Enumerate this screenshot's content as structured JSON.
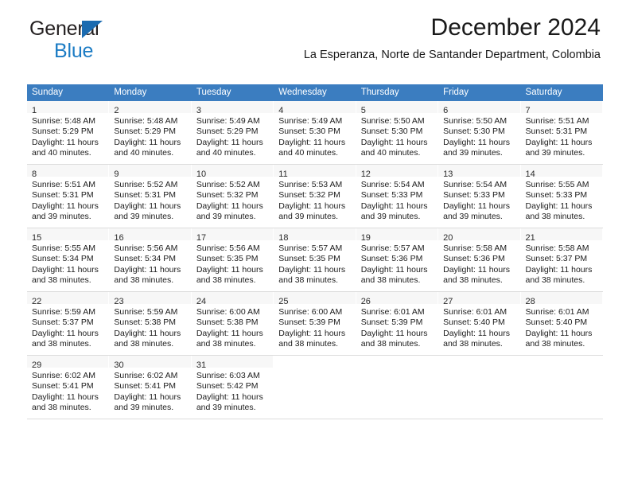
{
  "brand": {
    "name_part1": "General",
    "name_part2": "Blue",
    "triangle_color": "#1b6bb0",
    "blue_color": "#1b7bc4"
  },
  "header": {
    "title": "December 2024",
    "subtitle": "La Esperanza, Norte de Santander Department, Colombia"
  },
  "calendar": {
    "header_background": "#3b7dc0",
    "header_text_color": "#ffffff",
    "weekday_headers": [
      "Sunday",
      "Monday",
      "Tuesday",
      "Wednesday",
      "Thursday",
      "Friday",
      "Saturday"
    ],
    "weeks": [
      [
        {
          "day": "1",
          "sunrise": "Sunrise: 5:48 AM",
          "sunset": "Sunset: 5:29 PM",
          "daylight_line1": "Daylight: 11 hours",
          "daylight_line2": "and 40 minutes."
        },
        {
          "day": "2",
          "sunrise": "Sunrise: 5:48 AM",
          "sunset": "Sunset: 5:29 PM",
          "daylight_line1": "Daylight: 11 hours",
          "daylight_line2": "and 40 minutes."
        },
        {
          "day": "3",
          "sunrise": "Sunrise: 5:49 AM",
          "sunset": "Sunset: 5:29 PM",
          "daylight_line1": "Daylight: 11 hours",
          "daylight_line2": "and 40 minutes."
        },
        {
          "day": "4",
          "sunrise": "Sunrise: 5:49 AM",
          "sunset": "Sunset: 5:30 PM",
          "daylight_line1": "Daylight: 11 hours",
          "daylight_line2": "and 40 minutes."
        },
        {
          "day": "5",
          "sunrise": "Sunrise: 5:50 AM",
          "sunset": "Sunset: 5:30 PM",
          "daylight_line1": "Daylight: 11 hours",
          "daylight_line2": "and 40 minutes."
        },
        {
          "day": "6",
          "sunrise": "Sunrise: 5:50 AM",
          "sunset": "Sunset: 5:30 PM",
          "daylight_line1": "Daylight: 11 hours",
          "daylight_line2": "and 39 minutes."
        },
        {
          "day": "7",
          "sunrise": "Sunrise: 5:51 AM",
          "sunset": "Sunset: 5:31 PM",
          "daylight_line1": "Daylight: 11 hours",
          "daylight_line2": "and 39 minutes."
        }
      ],
      [
        {
          "day": "8",
          "sunrise": "Sunrise: 5:51 AM",
          "sunset": "Sunset: 5:31 PM",
          "daylight_line1": "Daylight: 11 hours",
          "daylight_line2": "and 39 minutes."
        },
        {
          "day": "9",
          "sunrise": "Sunrise: 5:52 AM",
          "sunset": "Sunset: 5:31 PM",
          "daylight_line1": "Daylight: 11 hours",
          "daylight_line2": "and 39 minutes."
        },
        {
          "day": "10",
          "sunrise": "Sunrise: 5:52 AM",
          "sunset": "Sunset: 5:32 PM",
          "daylight_line1": "Daylight: 11 hours",
          "daylight_line2": "and 39 minutes."
        },
        {
          "day": "11",
          "sunrise": "Sunrise: 5:53 AM",
          "sunset": "Sunset: 5:32 PM",
          "daylight_line1": "Daylight: 11 hours",
          "daylight_line2": "and 39 minutes."
        },
        {
          "day": "12",
          "sunrise": "Sunrise: 5:54 AM",
          "sunset": "Sunset: 5:33 PM",
          "daylight_line1": "Daylight: 11 hours",
          "daylight_line2": "and 39 minutes."
        },
        {
          "day": "13",
          "sunrise": "Sunrise: 5:54 AM",
          "sunset": "Sunset: 5:33 PM",
          "daylight_line1": "Daylight: 11 hours",
          "daylight_line2": "and 39 minutes."
        },
        {
          "day": "14",
          "sunrise": "Sunrise: 5:55 AM",
          "sunset": "Sunset: 5:33 PM",
          "daylight_line1": "Daylight: 11 hours",
          "daylight_line2": "and 38 minutes."
        }
      ],
      [
        {
          "day": "15",
          "sunrise": "Sunrise: 5:55 AM",
          "sunset": "Sunset: 5:34 PM",
          "daylight_line1": "Daylight: 11 hours",
          "daylight_line2": "and 38 minutes."
        },
        {
          "day": "16",
          "sunrise": "Sunrise: 5:56 AM",
          "sunset": "Sunset: 5:34 PM",
          "daylight_line1": "Daylight: 11 hours",
          "daylight_line2": "and 38 minutes."
        },
        {
          "day": "17",
          "sunrise": "Sunrise: 5:56 AM",
          "sunset": "Sunset: 5:35 PM",
          "daylight_line1": "Daylight: 11 hours",
          "daylight_line2": "and 38 minutes."
        },
        {
          "day": "18",
          "sunrise": "Sunrise: 5:57 AM",
          "sunset": "Sunset: 5:35 PM",
          "daylight_line1": "Daylight: 11 hours",
          "daylight_line2": "and 38 minutes."
        },
        {
          "day": "19",
          "sunrise": "Sunrise: 5:57 AM",
          "sunset": "Sunset: 5:36 PM",
          "daylight_line1": "Daylight: 11 hours",
          "daylight_line2": "and 38 minutes."
        },
        {
          "day": "20",
          "sunrise": "Sunrise: 5:58 AM",
          "sunset": "Sunset: 5:36 PM",
          "daylight_line1": "Daylight: 11 hours",
          "daylight_line2": "and 38 minutes."
        },
        {
          "day": "21",
          "sunrise": "Sunrise: 5:58 AM",
          "sunset": "Sunset: 5:37 PM",
          "daylight_line1": "Daylight: 11 hours",
          "daylight_line2": "and 38 minutes."
        }
      ],
      [
        {
          "day": "22",
          "sunrise": "Sunrise: 5:59 AM",
          "sunset": "Sunset: 5:37 PM",
          "daylight_line1": "Daylight: 11 hours",
          "daylight_line2": "and 38 minutes."
        },
        {
          "day": "23",
          "sunrise": "Sunrise: 5:59 AM",
          "sunset": "Sunset: 5:38 PM",
          "daylight_line1": "Daylight: 11 hours",
          "daylight_line2": "and 38 minutes."
        },
        {
          "day": "24",
          "sunrise": "Sunrise: 6:00 AM",
          "sunset": "Sunset: 5:38 PM",
          "daylight_line1": "Daylight: 11 hours",
          "daylight_line2": "and 38 minutes."
        },
        {
          "day": "25",
          "sunrise": "Sunrise: 6:00 AM",
          "sunset": "Sunset: 5:39 PM",
          "daylight_line1": "Daylight: 11 hours",
          "daylight_line2": "and 38 minutes."
        },
        {
          "day": "26",
          "sunrise": "Sunrise: 6:01 AM",
          "sunset": "Sunset: 5:39 PM",
          "daylight_line1": "Daylight: 11 hours",
          "daylight_line2": "and 38 minutes."
        },
        {
          "day": "27",
          "sunrise": "Sunrise: 6:01 AM",
          "sunset": "Sunset: 5:40 PM",
          "daylight_line1": "Daylight: 11 hours",
          "daylight_line2": "and 38 minutes."
        },
        {
          "day": "28",
          "sunrise": "Sunrise: 6:01 AM",
          "sunset": "Sunset: 5:40 PM",
          "daylight_line1": "Daylight: 11 hours",
          "daylight_line2": "and 38 minutes."
        }
      ],
      [
        {
          "day": "29",
          "sunrise": "Sunrise: 6:02 AM",
          "sunset": "Sunset: 5:41 PM",
          "daylight_line1": "Daylight: 11 hours",
          "daylight_line2": "and 38 minutes."
        },
        {
          "day": "30",
          "sunrise": "Sunrise: 6:02 AM",
          "sunset": "Sunset: 5:41 PM",
          "daylight_line1": "Daylight: 11 hours",
          "daylight_line2": "and 39 minutes."
        },
        {
          "day": "31",
          "sunrise": "Sunrise: 6:03 AM",
          "sunset": "Sunset: 5:42 PM",
          "daylight_line1": "Daylight: 11 hours",
          "daylight_line2": "and 39 minutes."
        },
        null,
        null,
        null,
        null
      ]
    ]
  }
}
